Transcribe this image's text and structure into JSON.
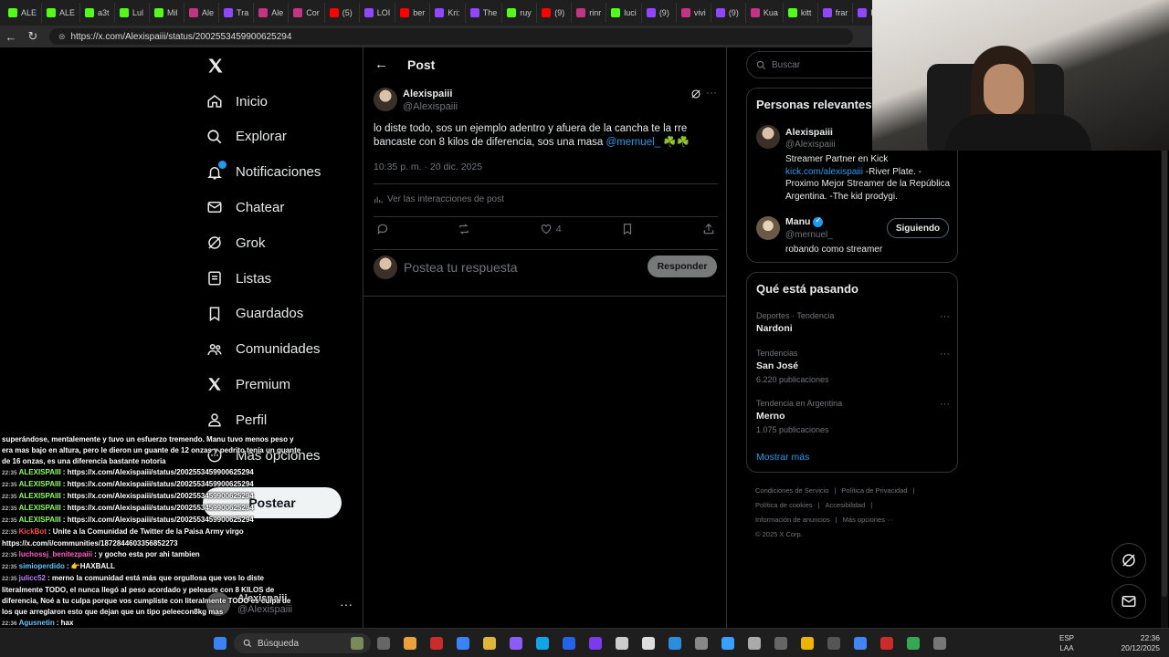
{
  "browser": {
    "tabs": [
      "ALE",
      "ALE",
      "a3t",
      "Lul",
      "Mil",
      "Ale",
      "Tra",
      "Ale",
      "Cor",
      "(5)",
      "LOI",
      "ber",
      "Kri:",
      "The",
      "ruy",
      "(9)",
      "rinr",
      "luci",
      "(9)",
      "vivi",
      "(9)",
      "Kua",
      "kitt",
      "frar",
      "Kw:",
      "Alc",
      "A"
    ],
    "url": "https://x.com/Alexispaiii/status/2002553459900625294"
  },
  "nav": {
    "items": [
      {
        "label": "Inicio",
        "icon": "home-icon"
      },
      {
        "label": "Explorar",
        "icon": "search-icon"
      },
      {
        "label": "Notificaciones",
        "icon": "bell-icon"
      },
      {
        "label": "Chatear",
        "icon": "mail-icon"
      },
      {
        "label": "Grok",
        "icon": "grok-icon"
      },
      {
        "label": "Listas",
        "icon": "list-icon"
      },
      {
        "label": "Guardados",
        "icon": "bookmark-icon"
      },
      {
        "label": "Comunidades",
        "icon": "people-icon"
      },
      {
        "label": "Premium",
        "icon": "x-icon"
      },
      {
        "label": "Perfil",
        "icon": "person-icon"
      },
      {
        "label": "Más opciones",
        "icon": "more-circle-icon"
      }
    ],
    "post_button": "Postear",
    "profile": {
      "name": "Alexispaiii",
      "handle": "@Alexispaiii"
    }
  },
  "post": {
    "header_title": "Post",
    "author_name": "Alexispaiii",
    "author_handle": "@Alexispaiii",
    "text_1": "lo diste todo, sos un ejemplo adentro y afuera de la cancha te la rre bancaste con 8 kilos de diferencia, sos una masa ",
    "mention": "@mernuel_",
    "clovers": " ☘️☘️",
    "timestamp": "10:35 p. m. · 20 dic. 2025",
    "interactions_link": "Ver las interacciones de post",
    "like_count": "4",
    "reply_placeholder": "Postea tu respuesta",
    "reply_button": "Responder"
  },
  "sidebar": {
    "search_placeholder": "Buscar",
    "relevant_title": "Personas relevantes",
    "people": [
      {
        "name": "Alexispaiii",
        "handle": "@Alexispaiii",
        "bio_1": "Streamer Partner en Kick ",
        "bio_link": "kick.com/alexispaiii",
        "bio_2": " -River Plate. -Proximo Mejor Streamer de la República Argentina. -The kid prodygi."
      },
      {
        "name": "Manu",
        "handle": "@mernuel_",
        "bio": "robando como streamer",
        "follow_label": "Siguiendo"
      }
    ],
    "trends_title": "Qué está pasando",
    "trends": [
      {
        "category": "Deportes · Tendencia",
        "title": "Nardoni",
        "count": ""
      },
      {
        "category": "Tendencias",
        "title": "San José",
        "count": "6.220 publicaciones"
      },
      {
        "category": "Tendencia en Argentina",
        "title": "Merno",
        "count": "1.075 publicaciones"
      }
    ],
    "show_more": "Mostrar más",
    "footer": [
      "Condiciones de Servicio",
      "|",
      "Política de Privacidad",
      "|",
      "Política de cookies",
      "|",
      "Accesibilidad",
      "|",
      "Información de anuncios",
      "|",
      "Más opciones ···",
      "© 2025 X Corp."
    ]
  },
  "chat": {
    "lines": [
      {
        "ts": "",
        "user": "",
        "text": "superándose, mentalemente y tuvo un esfuerzo tremendo. Manu tuvo menos peso y era mas bajo en altura, pero le dieron un guante de 12 onzas y pedrito tenía un guante de 16 onzas, es una diferencia bastante notoria",
        "color": "#ffffff"
      },
      {
        "ts": "22:35",
        "user": "ALEXISPAIII",
        "text": ": https://x.com/Alexispaiii/status/2002553459900625294",
        "color": "#8bff5a"
      },
      {
        "ts": "22:35",
        "user": "ALEXISPAIII",
        "text": ": https://x.com/Alexispaiii/status/2002553459900625294",
        "color": "#8bff5a"
      },
      {
        "ts": "22:35",
        "user": "ALEXISPAIII",
        "text": ": https://x.com/Alexispaiii/status/2002553459900625294",
        "color": "#8bff5a"
      },
      {
        "ts": "22:35",
        "user": "ALEXISPAIII",
        "text": ": https://x.com/Alexispaiii/status/2002553459900625294",
        "color": "#8bff5a"
      },
      {
        "ts": "22:35",
        "user": "ALEXISPAIII",
        "text": ": https://x.com/Alexispaiii/status/2002553459900625294",
        "color": "#8bff5a"
      },
      {
        "ts": "22:35",
        "user": "KickBot",
        "text": ": Unite a la Comunidad de Twitter de la Paisa Army virgo https://x.com/i/communities/1872844603356852273",
        "color": "#ff4a4a"
      },
      {
        "ts": "22:35",
        "user": "luchossj_benitezpaiii",
        "text": ": y gocho esta por ahi tambien",
        "color": "#ff5ec4"
      },
      {
        "ts": "22:35",
        "user": "simioperdido",
        "text": ": 👉HAXBALL",
        "color": "#5ac8ff"
      },
      {
        "ts": "22:35",
        "user": "julicc52",
        "text": ": merno la comunidad está más que orgullosa que vos lo diste literalmente TODO, el nunca llegó al peso acordado y peleaste con 8 KILOS de diferencia, Noé a tu culpa porque vos cumpliste con literalmente TODO es culpa de los que arreglaron esto que dejan que un tipo peleecon8kg mas",
        "color": "#c084ff"
      },
      {
        "ts": "22:36",
        "user": "Agusnetin",
        "text": ": hax",
        "color": "#5ac8ff"
      }
    ]
  },
  "taskbar": {
    "search_label": "Búsqueda",
    "lang_1": "ESP",
    "lang_2": "LAA",
    "time": "22:36",
    "date": "20/12/2025"
  },
  "colors": {
    "accent": "#1d9bf0",
    "background": "#000000",
    "border": "#2f3336",
    "muted": "#71767b"
  }
}
